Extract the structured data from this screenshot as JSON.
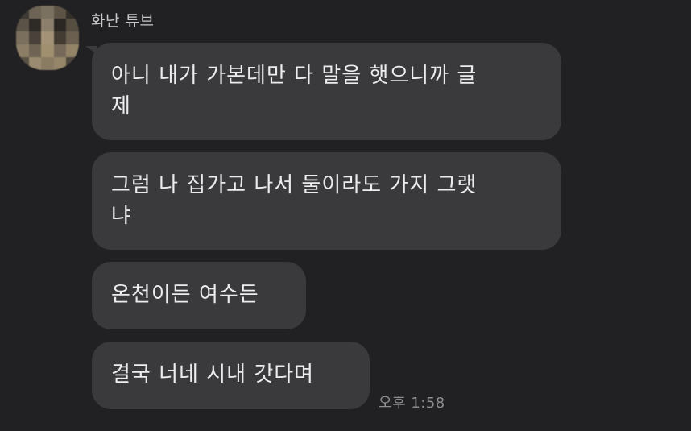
{
  "chat": {
    "sender_name": "화난 튜브",
    "messages": [
      {
        "text": "아니 내가 가본데만 다 말을 햇으니까 글\n제"
      },
      {
        "text": "그럼 나 집가고 나서 둘이라도 가지 그랫\n냐"
      },
      {
        "text": "온천이든 여수든"
      },
      {
        "text": "결국 너네 시내 갓다며"
      }
    ],
    "timestamp": "오후 1:58"
  },
  "colors": {
    "background": "#212123",
    "bubble": "#3a3a3d",
    "text": "#ececee",
    "timestamp": "#8e8e92"
  }
}
